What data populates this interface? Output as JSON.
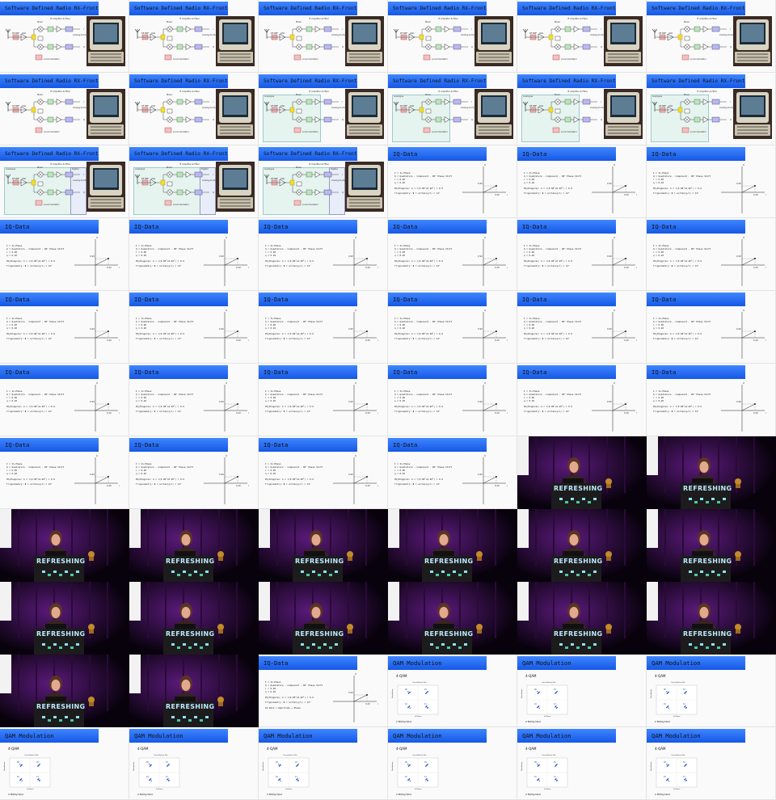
{
  "slide_titles": {
    "sdr": "Software Defined Radio RX-Frontend",
    "iq": "IQ-Data",
    "qam": "QAM Modulation"
  },
  "sdr_labels": {
    "mixer": "Mixer",
    "filter": "IF Amplifier & Filter",
    "bpf": "RF BPF",
    "lna": "LNA",
    "dsp": "Analog-to-Digital Converter",
    "osc": "Local Oscillator",
    "i": "I",
    "q": "Q",
    "analogue": "Analogue",
    "digital": "Digital"
  },
  "iq_text": {
    "line1": "I = In-Phase",
    "line2": "Q = Quadrature - Component - 90° Phase Shift",
    "line3": "i = 0.90",
    "line4": "q = 0.20",
    "pyth": "Phythagoras: A = √(0.90²+0.20²) = 0.9",
    "trig": "Trigonometry: Φ = arctan(q/i) = 12°",
    "extra": "IQ-Data = Amplitude + Phase",
    "tick_a": "0.90",
    "tick_b": "0.20",
    "axis_q": "Q",
    "axis_i": "I"
  },
  "qam_text": {
    "heading": "4-QAM",
    "plot_title": "Constellation Plot",
    "footer": "2 Bit/Symbol",
    "xlabel": "In-Phase",
    "ylabel": "Quadrature",
    "point_labels": [
      "00",
      "01",
      "10",
      "11"
    ]
  },
  "stage_logo": "REFRESHING",
  "tiles": [
    "sdr",
    "sdr",
    "sdr",
    "sdr",
    "sdr",
    "sdr",
    "sdr",
    "sdr",
    "sdr2",
    "sdr2",
    "sdr2",
    "sdr2",
    "sdr3",
    "sdr3",
    "sdr3",
    "iq",
    "iq",
    "iq",
    "iq",
    "iq",
    "iq",
    "iq",
    "iq",
    "iq",
    "iq",
    "iq",
    "iq",
    "iq",
    "iq",
    "iq",
    "iq",
    "iq",
    "iq",
    "iq",
    "iq",
    "iq",
    "iq",
    "iq",
    "iq",
    "iq",
    "stage",
    "stage",
    "stage",
    "stage",
    "stage",
    "stage",
    "stage",
    "stage",
    "stage",
    "stage",
    "stage",
    "stage",
    "stage",
    "stage",
    "stage",
    "stage",
    "iq2",
    "qam",
    "qam",
    "qam",
    "qam",
    "qam",
    "qam",
    "qam",
    "qam",
    "qam"
  ],
  "colors": {
    "banner_start": "#3f86ff",
    "banner_end": "#1558e6",
    "stage_purple": "#5a1a7a",
    "qam_point": "#2255cc"
  }
}
